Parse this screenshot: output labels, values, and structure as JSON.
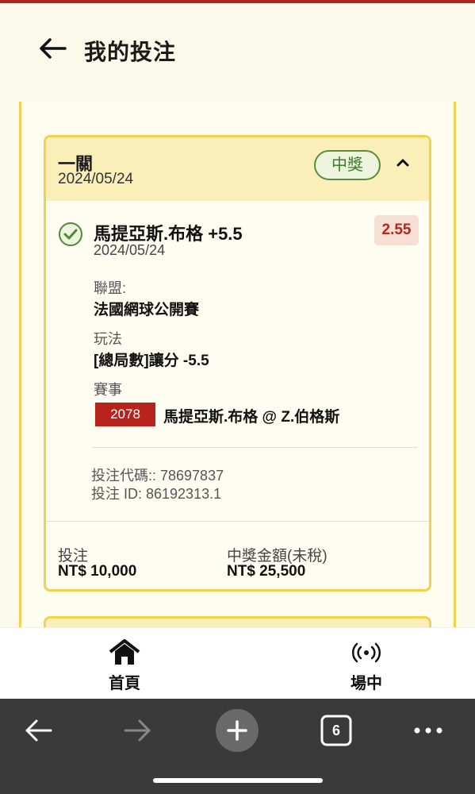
{
  "header": {
    "title": "我的投注"
  },
  "card": {
    "type": "一關",
    "date": "2024/05/24",
    "status": "中獎",
    "selection": {
      "name": "馬提亞斯.布格 +5.5",
      "date": "2024/05/24",
      "odds": "2.55"
    },
    "league_label": "聯盟:",
    "league_value": "法國網球公開賽",
    "market_label": "玩法",
    "market_value": "[總局數]讓分 -5.5",
    "event_label": "賽事",
    "event_id": "2078",
    "event_name": "馬提亞斯.布格 @ Z.伯格斯",
    "bet_code": "投注代碼:: 78697837",
    "bet_id": "投注 ID: 86192313.1",
    "stake_label": "投注",
    "stake_value": "NT$ 10,000",
    "payout_label": "中獎金額(未稅)",
    "payout_value": "NT$ 25,500"
  },
  "bottom_nav": [
    {
      "label": "首頁",
      "icon": "home-icon"
    },
    {
      "label": "場中",
      "icon": "live-broadcast-icon"
    }
  ],
  "browser": {
    "tab_count": "6"
  },
  "colors": {
    "accent_red": "#b8231c",
    "card_border": "#f1d24e",
    "win_green": "#3f7a2a"
  }
}
